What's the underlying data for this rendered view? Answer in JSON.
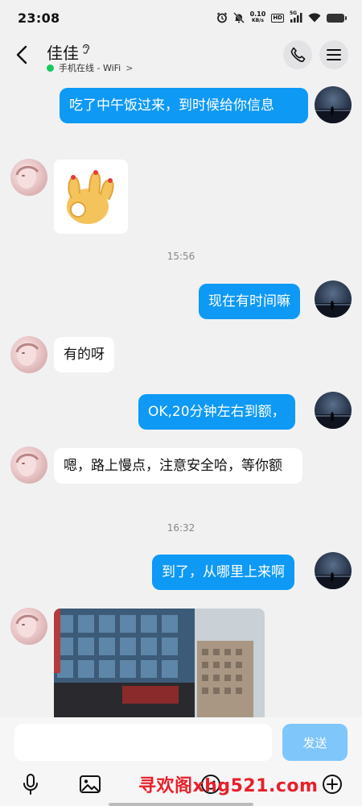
{
  "status_bar": {
    "time": "23:08",
    "net_speed_value": "0.10",
    "net_speed_unit": "KB/s",
    "hd_badge": "HD",
    "signal_label": "5G"
  },
  "header": {
    "contact_name": "佳佳",
    "online_status": "手机在线 - WiFi",
    "online_chevron": ">"
  },
  "messages": [
    {
      "sender": "self",
      "type": "text",
      "text": "吃了中午饭过来，到时候给你信息"
    },
    {
      "sender": "other",
      "type": "sticker",
      "sticker_name": "ok-hand-sticker"
    },
    {
      "type": "timestamp",
      "text": "15:56"
    },
    {
      "sender": "self",
      "type": "text",
      "text": "现在有时间嘛"
    },
    {
      "sender": "other",
      "type": "text",
      "text": "有的呀"
    },
    {
      "sender": "self",
      "type": "text",
      "text": "OK,20分钟左右到额，"
    },
    {
      "sender": "other",
      "type": "text",
      "text": "嗯，路上慢点，注意安全哈，等你额"
    },
    {
      "type": "timestamp",
      "text": "16:32"
    },
    {
      "sender": "self",
      "type": "text",
      "text": "到了，从哪里上来啊"
    },
    {
      "sender": "other",
      "type": "image",
      "image_name": "building-photo"
    }
  ],
  "input": {
    "value": "",
    "placeholder": "",
    "send_label": "发送"
  },
  "toolbar": {
    "icons": [
      "microphone-icon",
      "image-icon",
      "emoji-icon",
      "add-icon"
    ],
    "watermark": "寻欢阁xhg521.com"
  },
  "colors": {
    "self_bubble": "#0e99f5",
    "other_bubble": "#ffffff",
    "background": "#f1f1f2",
    "send_button": "#7fc6fb",
    "online_dot": "#19c95a",
    "watermark": "#e8202a"
  }
}
